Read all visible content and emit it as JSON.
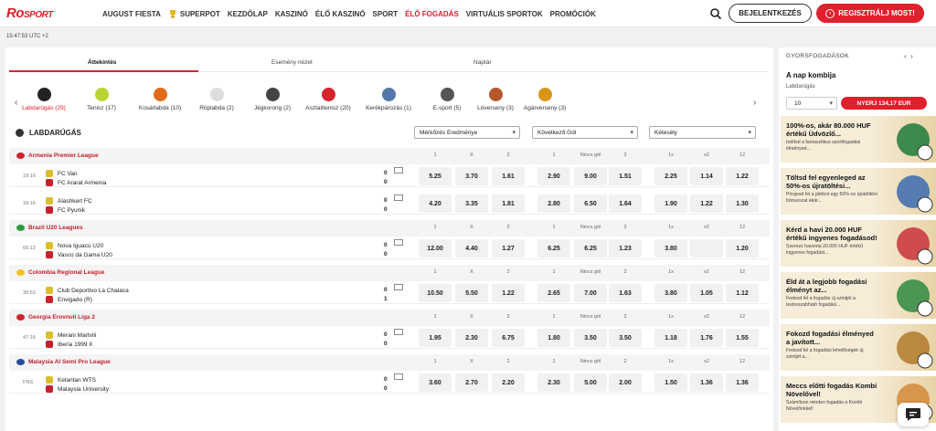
{
  "brand": {
    "logo_main": "Ro",
    "logo_sub": "SPORT"
  },
  "nav": {
    "items": [
      "AUGUST FIESTA",
      "SUPERPOT",
      "KEZDŐLAP",
      "KASZINÓ",
      "ÉLŐ KASZINÓ",
      "SPORT",
      "ÉLŐ FOGADÁS",
      "VIRTUÁLIS SPORTOK",
      "PROMÓCIÓK"
    ],
    "active": "ÉLŐ FOGADÁS",
    "login": "BEJELENTKEZÉS",
    "register": "REGISZTRÁLJ MOST!"
  },
  "time": "15:47:53 UTC +2",
  "tabs": [
    "Áttekintés",
    "Esemény nézet",
    "Naptár"
  ],
  "sports": [
    {
      "label": "Labdarúgás (29)",
      "icon": "football-icon",
      "color": "#222222"
    },
    {
      "label": "Tenisz (17)",
      "icon": "tennis-icon",
      "color": "#b8d432"
    },
    {
      "label": "Kosárlabda (10)",
      "icon": "basketball-icon",
      "color": "#e06a1a"
    },
    {
      "label": "Röplabda (2)",
      "icon": "volleyball-icon",
      "color": "#dddddd"
    },
    {
      "label": "Jégkorong (2)",
      "icon": "ice-hockey-icon",
      "color": "#444444"
    },
    {
      "label": "Asztalitenisz (20)",
      "icon": "table-tennis-icon",
      "color": "#d4242c"
    },
    {
      "label": "Kerékpározás (1)",
      "icon": "cycling-icon",
      "color": "#5577aa"
    },
    {
      "label": "E-sport (5)",
      "icon": "gamepad-icon",
      "color": "#555555"
    },
    {
      "label": "Lóverseny (3)",
      "icon": "horse-racing-icon",
      "color": "#b5562a"
    },
    {
      "label": "Agárverseny (3)",
      "icon": "greyhound-icon",
      "color": "#d9951a"
    }
  ],
  "section": {
    "title": "LABDARÚGÁS",
    "selects": [
      "Mérkőzés Eredménye",
      "Következő Gól",
      "Kétesély"
    ],
    "headers": [
      "1",
      "X",
      "2",
      "1",
      "Nincs gól",
      "2",
      "1x",
      "x2",
      "12"
    ]
  },
  "leagues": [
    {
      "name": "Armenia Premier League",
      "flag": "#d2232a",
      "matches": [
        {
          "time": "19:16",
          "home": "FC Van",
          "away": "FC Ararat Armenia",
          "hs": "0",
          "as": "0",
          "odds": [
            "5.25",
            "3.70",
            "1.61",
            "2.90",
            "9.00",
            "1.51",
            "2.25",
            "1.14",
            "1.22"
          ]
        },
        {
          "time": "18:16",
          "home": "Alashkert FC",
          "away": "FC Pyunik",
          "hs": "0",
          "as": "0",
          "odds": [
            "4.20",
            "3.35",
            "1.81",
            "2.80",
            "6.50",
            "1.64",
            "1.90",
            "1.22",
            "1.30"
          ]
        }
      ]
    },
    {
      "name": "Brazil U20 Leagues",
      "flag": "#2e9a3e",
      "matches": [
        {
          "time": "66:12",
          "home": "Nova Iguacu U20",
          "away": "Vasco da Gama U20",
          "hs": "0",
          "as": "0",
          "odds": [
            "12.00",
            "4.40",
            "1.27",
            "6.25",
            "6.25",
            "1.23",
            "3.80",
            "",
            "1.20"
          ]
        }
      ]
    },
    {
      "name": "Colombia Regional League",
      "flag": "#f2c318",
      "matches": [
        {
          "time": "38:53",
          "home": "Club Deportivo La Chalaca",
          "away": "Envigado (R)",
          "hs": "0",
          "as": "1",
          "odds": [
            "10.50",
            "5.50",
            "1.22",
            "2.65",
            "7.00",
            "1.63",
            "3.80",
            "1.05",
            "1.12"
          ]
        }
      ]
    },
    {
      "name": "Georgia Erovnuli Liga 2",
      "flag": "#d2232a",
      "matches": [
        {
          "time": "47:16",
          "home": "Merani Martvili",
          "away": "Iberia 1999 II",
          "hs": "0",
          "as": "0",
          "odds": [
            "1.95",
            "2.30",
            "6.75",
            "1.80",
            "3.50",
            "3.50",
            "1.18",
            "1.76",
            "1.55"
          ]
        }
      ]
    },
    {
      "name": "Malaysia Al Semi Pro League",
      "flag": "#2b4aa0",
      "matches": [
        {
          "time": "FNS",
          "home": "Kelantan WTS",
          "away": "Malaysia University",
          "hs": "0",
          "as": "0",
          "odds": [
            "3.60",
            "2.70",
            "2.20",
            "2.30",
            "5.00",
            "2.00",
            "1.50",
            "1.36",
            "1.36"
          ]
        }
      ]
    }
  ],
  "sidebar": {
    "title": "GYORSFOGADÁSOK",
    "combi": "A nap kombija",
    "sport": "Labdarúgás",
    "stake": "10",
    "win": "NYERJ 134,17 EUR",
    "promos": [
      {
        "title": "100%-os, akár 80.000 HUF értékű Üdvözlő...",
        "desc": "Indítsd a fantasztikus sportfogadási élményed..."
      },
      {
        "title": "Töltsd fel egyenleged az 50%-os újratöltési...",
        "desc": "Pörgesd fel a játékot egy 50%-os újratöltési bónusszal akár..."
      },
      {
        "title": "Kérd a havi 20.000 HUF értékű ingyenes fogadásod!",
        "desc": "Szerezz havonta 20.000 HUF értékű ingyenes fogadást..."
      },
      {
        "title": "Éld át a legjobb fogadási élményt az...",
        "desc": "Fedezd fel a fogadás új szintjét a testreszabható fogadási..."
      },
      {
        "title": "Fokozd fogadási élményed a javított...",
        "desc": "Fedezd fel a fogadási lehetőségek új szintjét a..."
      },
      {
        "title": "Meccs előtti fogadás Kombi Növelővel!",
        "desc": "Számítson minden fogadás a Kombi Növelőnkkel!"
      }
    ]
  }
}
